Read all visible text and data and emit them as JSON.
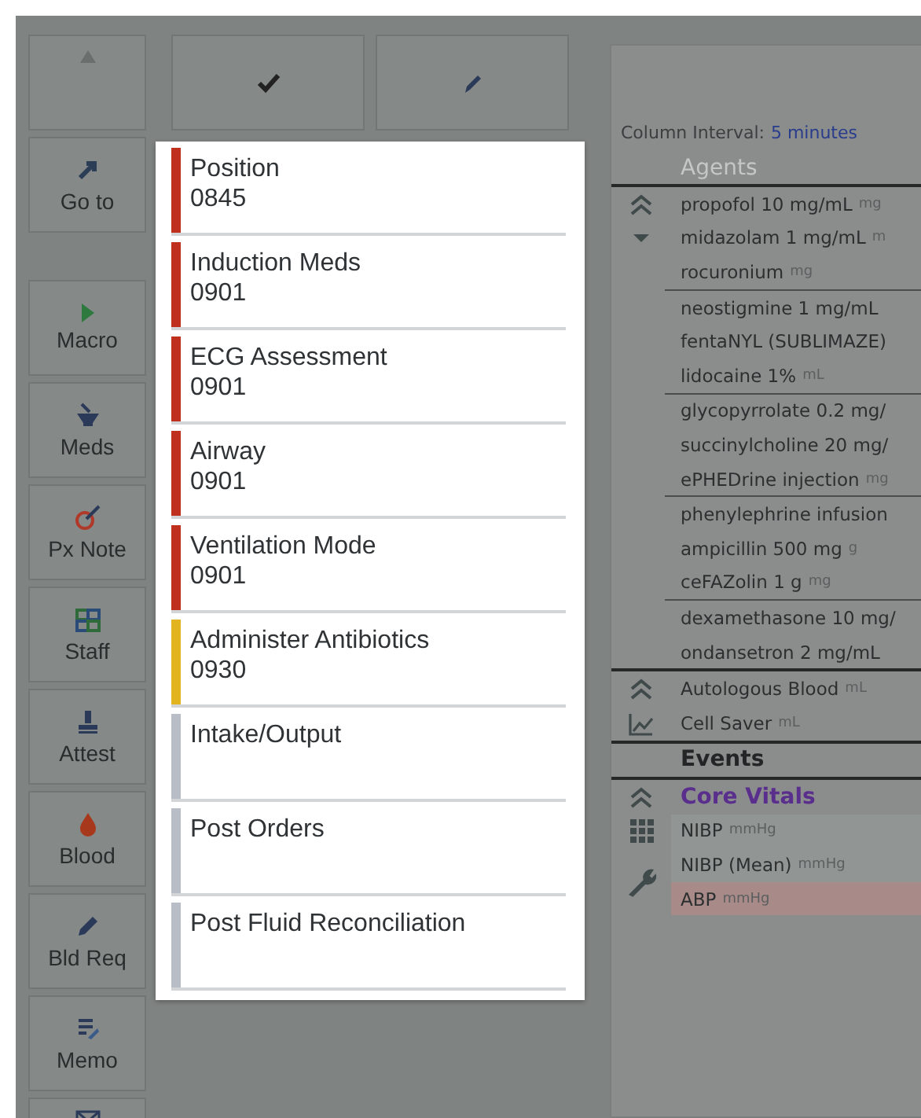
{
  "side_buttons": [
    {
      "kind": "up"
    },
    {
      "kind": "goto",
      "label": "Go to"
    },
    {
      "kind": "divider"
    },
    {
      "kind": "macro",
      "label": "Macro"
    },
    {
      "kind": "meds",
      "label": "Meds"
    },
    {
      "kind": "note",
      "label": "Px Note"
    },
    {
      "kind": "staff",
      "label": "Staff"
    },
    {
      "kind": "attest",
      "label": "Attest"
    },
    {
      "kind": "blood",
      "label": "Blood"
    },
    {
      "kind": "request",
      "label": "Bld Req"
    },
    {
      "kind": "memo",
      "label": "Memo"
    },
    {
      "kind": "mail"
    }
  ],
  "toolbar": [
    {
      "kind": "check"
    },
    {
      "kind": "edit"
    }
  ],
  "popup_items": [
    {
      "title": "Position",
      "time": "0845",
      "color": "#c0301f"
    },
    {
      "title": "Induction Meds",
      "time": "0901",
      "color": "#c0301f"
    },
    {
      "title": "ECG Assessment",
      "time": "0901",
      "color": "#c0301f"
    },
    {
      "title": "Airway",
      "time": "0901",
      "color": "#c0301f"
    },
    {
      "title": "Ventilation Mode",
      "time": "0901",
      "color": "#c0301f"
    },
    {
      "title": "Administer Antibiotics",
      "time": "0930",
      "color": "#e2b420"
    },
    {
      "title": "Intake/Output",
      "color": "#b9bdc6"
    },
    {
      "title": "Post Orders",
      "color": "#b9bdc6"
    },
    {
      "title": "Post Fluid Reconciliation",
      "color": "#b9bdc6"
    }
  ],
  "flowsheet": {
    "interval_label": "Column Interval:",
    "interval_value": "5 minutes",
    "agents_heading": "Agents",
    "agent_groups": [
      [
        {
          "name": "propofol 10 mg/mL",
          "unit": "mg"
        },
        {
          "name": "midazolam 1 mg/mL",
          "unit": "m"
        },
        {
          "name": "rocuronium",
          "unit": "mg"
        }
      ],
      [
        {
          "name": "neostigmine 1 mg/mL"
        },
        {
          "name": "fentaNYL (SUBLIMAZE)"
        },
        {
          "name": "lidocaine 1%",
          "unit": "mL"
        }
      ],
      [
        {
          "name": "glycopyrrolate 0.2 mg/"
        },
        {
          "name": "succinylcholine 20 mg/"
        },
        {
          "name": "ePHEDrine injection",
          "unit": "mg"
        }
      ],
      [
        {
          "name": "phenylephrine infusion"
        },
        {
          "name": "ampicillin 500 mg",
          "unit": "g"
        },
        {
          "name": "ceFAZolin 1 g",
          "unit": "mg"
        }
      ],
      [
        {
          "name": "dexamethasone 10 mg/"
        },
        {
          "name": "ondansetron 2 mg/mL"
        }
      ]
    ],
    "blood_rows": [
      {
        "name": "Autologous Blood",
        "unit": "mL"
      },
      {
        "name": "Cell Saver",
        "unit": "mL"
      }
    ],
    "events_heading": "Events",
    "vitals_heading": "Core Vitals",
    "vitals_rows": [
      {
        "name": "NIBP",
        "unit": "mmHg",
        "alert": false
      },
      {
        "name": "NIBP (Mean)",
        "unit": "mmHg",
        "alert": false
      },
      {
        "name": "ABP",
        "unit": "mmHg",
        "alert": true
      }
    ]
  }
}
